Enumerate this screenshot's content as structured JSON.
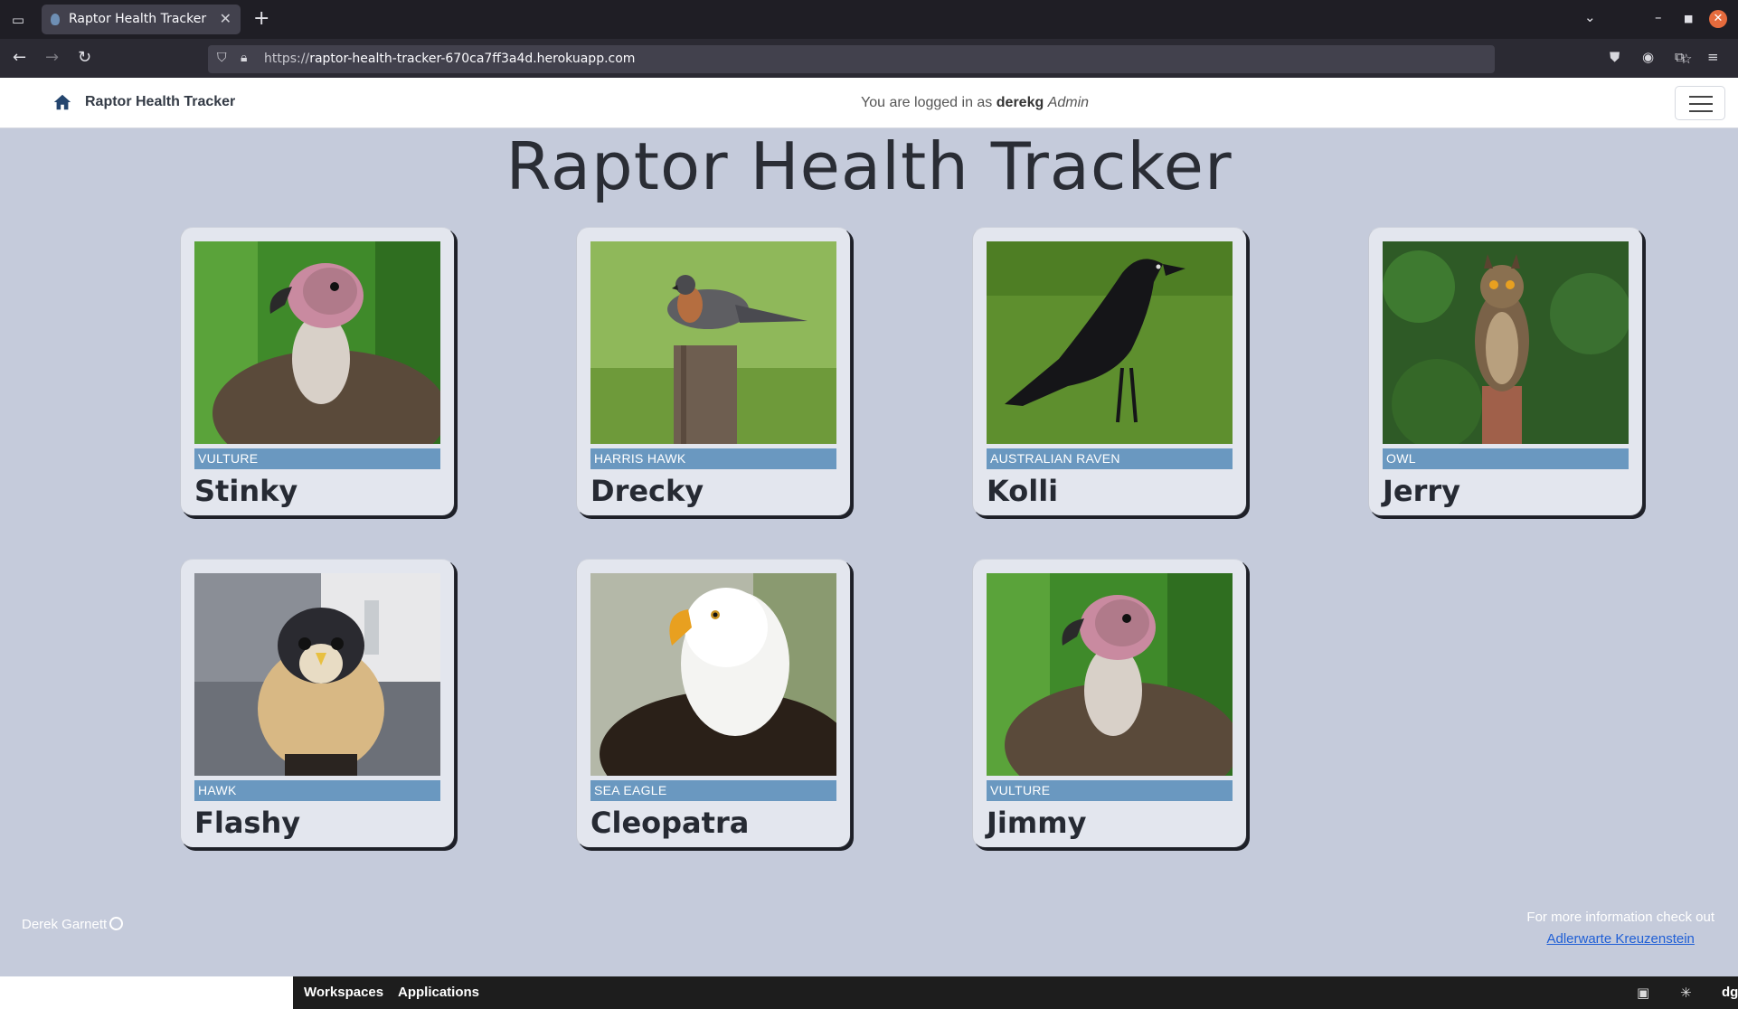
{
  "browser": {
    "tab_title": "Raptor Health Tracker",
    "url_prefix": "https://",
    "url_host": "raptor-health-tracker-670ca7ff3a4d.herokuapp.com"
  },
  "header": {
    "brand": "Raptor Health Tracker",
    "login_prefix": "You are logged in as",
    "username": "derekg",
    "role": "Admin"
  },
  "page": {
    "title": "Raptor Health Tracker"
  },
  "birds": [
    {
      "species": "VULTURE",
      "name": "Stinky",
      "icon": "vulture-photo"
    },
    {
      "species": "HARRIS HAWK",
      "name": "Drecky",
      "icon": "hawk-photo"
    },
    {
      "species": "AUSTRALIAN RAVEN",
      "name": "Kolli",
      "icon": "raven-photo"
    },
    {
      "species": "OWL",
      "name": "Jerry",
      "icon": "owl-photo"
    },
    {
      "species": "HAWK",
      "name": "Flashy",
      "icon": "falcon-photo"
    },
    {
      "species": "SEA EAGLE",
      "name": "Cleopatra",
      "icon": "eagle-photo"
    },
    {
      "species": "VULTURE",
      "name": "Jimmy",
      "icon": "vulture-photo"
    }
  ],
  "footer": {
    "author": "Derek Garnett",
    "info_text": "For more information check out",
    "link_text": "Adlerwarte Kreuzenstein"
  },
  "taskbar": {
    "workspaces": "Workspaces",
    "applications": "Applications",
    "tray_label": "dg"
  },
  "colors": {
    "page_bg": "#c5cbdb",
    "species_band": "#6a98c0",
    "card_bg": "#e3e6ee"
  }
}
